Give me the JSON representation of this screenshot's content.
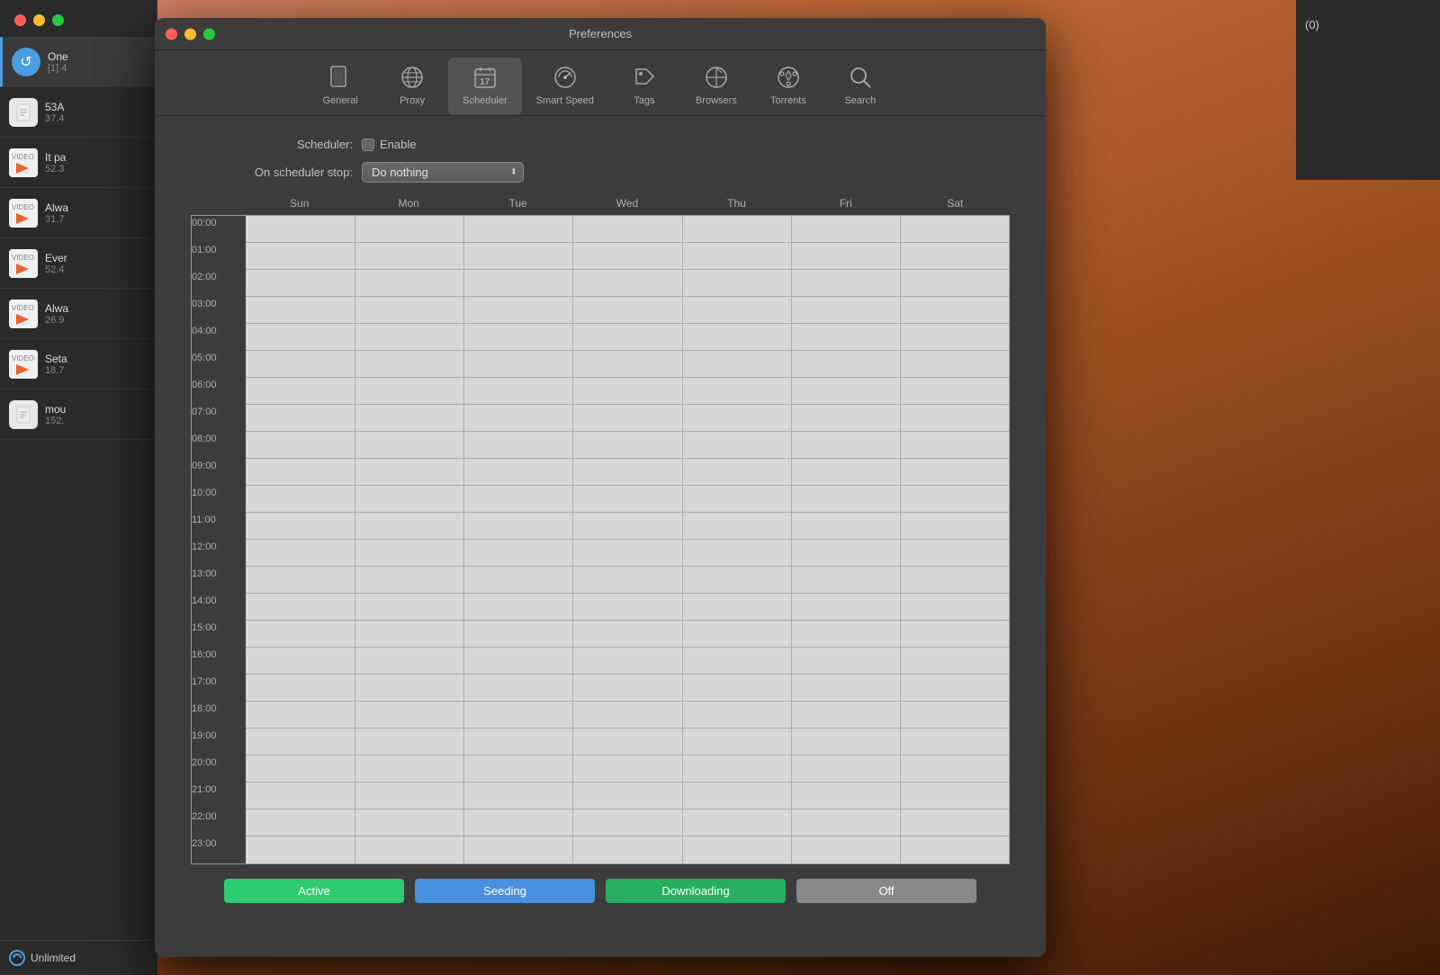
{
  "desktop": {
    "bg": "#8b4513"
  },
  "window": {
    "title": "Preferences"
  },
  "toolbar": {
    "items": [
      {
        "id": "general",
        "label": "General",
        "icon": "phone"
      },
      {
        "id": "proxy",
        "label": "Proxy",
        "icon": "globe"
      },
      {
        "id": "scheduler",
        "label": "Scheduler",
        "icon": "calendar",
        "active": true
      },
      {
        "id": "smart-speed",
        "label": "Smart Speed",
        "icon": "gauge"
      },
      {
        "id": "tags",
        "label": "Tags",
        "icon": "tag"
      },
      {
        "id": "browsers",
        "label": "Browsers",
        "icon": "compass"
      },
      {
        "id": "torrents",
        "label": "Torrents",
        "icon": "gear"
      },
      {
        "id": "search",
        "label": "Search",
        "icon": "search"
      }
    ]
  },
  "scheduler": {
    "label": "Scheduler:",
    "enable_label": "Enable",
    "stop_label": "On scheduler stop:",
    "stop_value": "Do nothing",
    "days": [
      "Sun",
      "Mon",
      "Tue",
      "Wed",
      "Thu",
      "Fri",
      "Sat"
    ],
    "hours": [
      "00:00",
      "01:00",
      "02:00",
      "03:00",
      "04:00",
      "05:00",
      "06:00",
      "07:00",
      "08:00",
      "09:00",
      "10:00",
      "11:00",
      "12:00",
      "13:00",
      "14:00",
      "15:00",
      "16:00",
      "17:00",
      "18:00",
      "19:00",
      "20:00",
      "21:00",
      "22:00",
      "23:00"
    ],
    "legend": [
      {
        "id": "active",
        "label": "Active",
        "color": "#00c87a"
      },
      {
        "id": "seeding",
        "label": "Seeding",
        "color": "#4a90e0"
      },
      {
        "id": "downloading",
        "label": "Downloading",
        "color": "#2ecc40"
      },
      {
        "id": "off",
        "label": "Off",
        "color": "#888888"
      }
    ]
  },
  "sidebar": {
    "items": [
      {
        "icon": "↺",
        "name": "One",
        "size": "[1] 4",
        "type": "circle-blue"
      },
      {
        "icon": "📄",
        "name": "53A",
        "size": "37.4",
        "type": "doc"
      },
      {
        "icon": "🎬",
        "name": "It pa",
        "size": "52.3",
        "type": "video"
      },
      {
        "icon": "🎬",
        "name": "Alwa",
        "size": "31.7",
        "type": "video"
      },
      {
        "icon": "🎬",
        "name": "Ever",
        "size": "52.4",
        "type": "video"
      },
      {
        "icon": "🎬",
        "name": "Alwa",
        "size": "26.9",
        "type": "video"
      },
      {
        "icon": "🎬",
        "name": "Seta",
        "size": "18.7",
        "type": "video"
      },
      {
        "icon": "📄",
        "name": "mou",
        "size": "152.",
        "type": "doc"
      }
    ],
    "bottom_label": "Unlimited"
  },
  "right_panel": {
    "count": "(0)"
  }
}
